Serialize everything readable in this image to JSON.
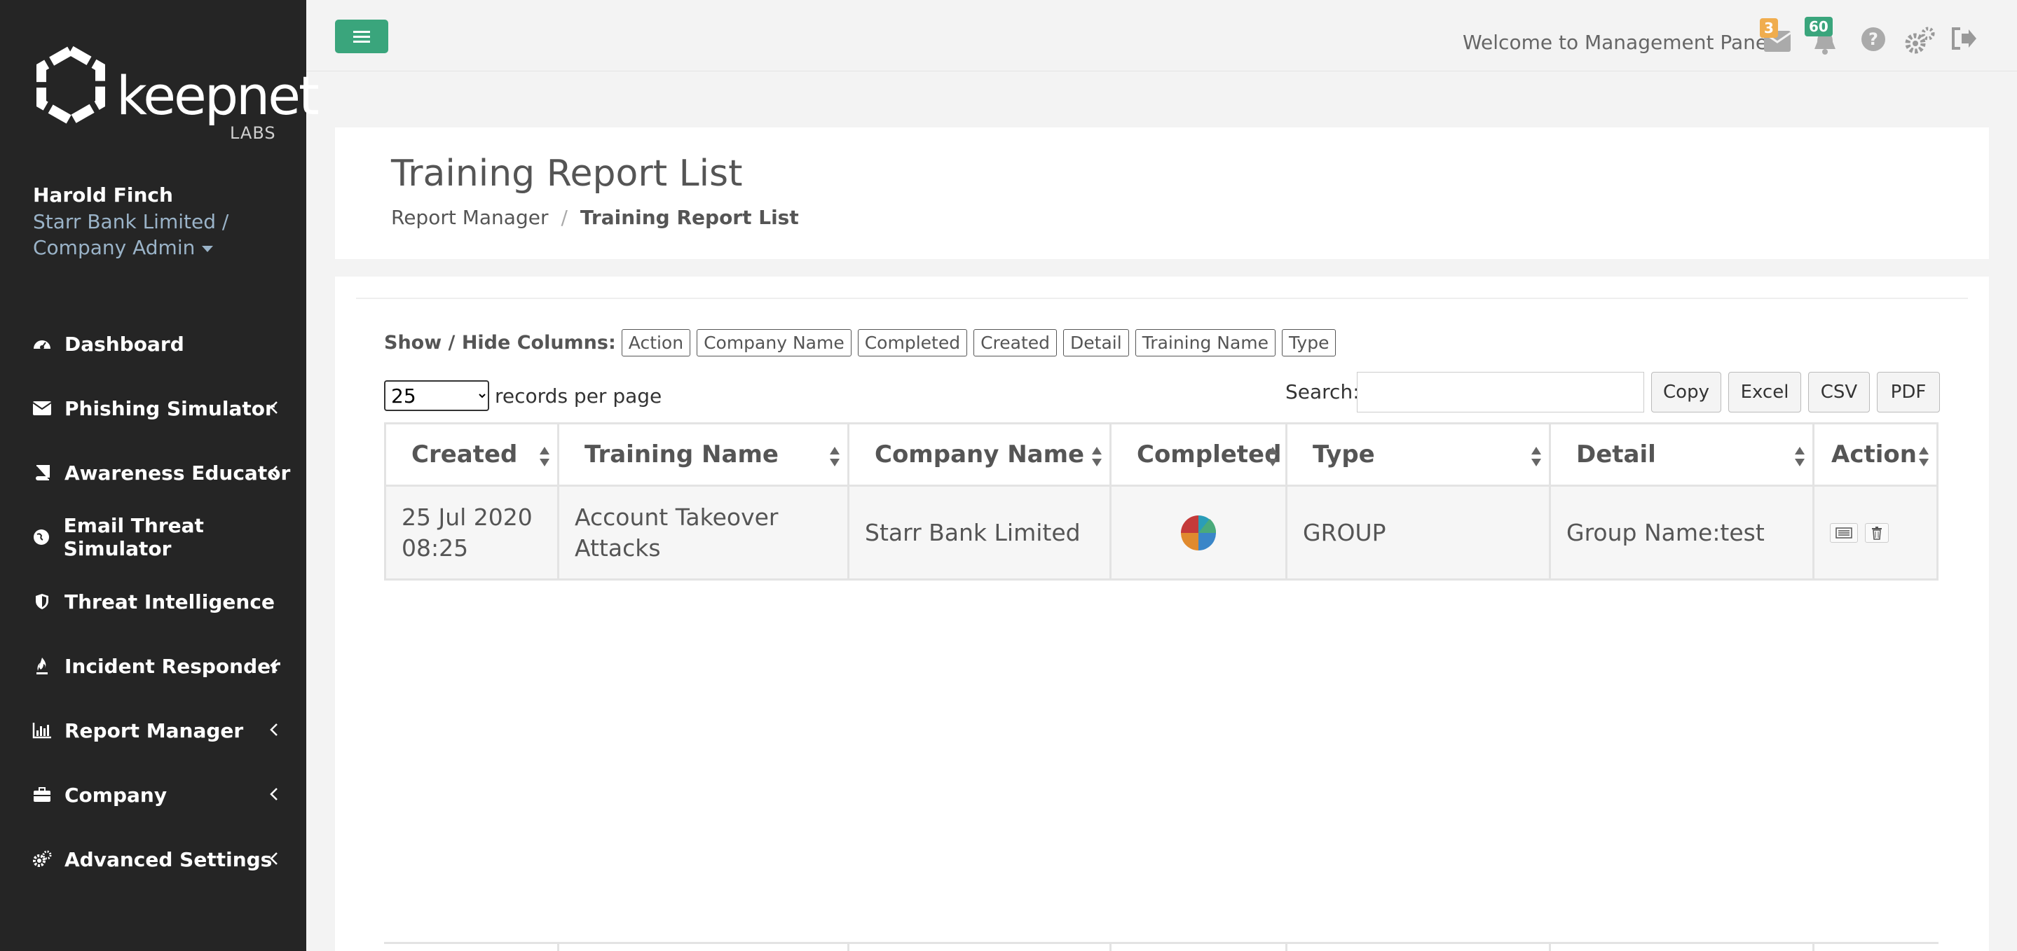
{
  "brand": {
    "name": "keepnet",
    "sub": "LABS"
  },
  "user": {
    "name": "Harold Finch",
    "org_line1": "Starr Bank Limited /",
    "org_line2": "Company Admin"
  },
  "sidebar": {
    "items": [
      {
        "label": "Dashboard",
        "icon": "dashboard-icon",
        "has_chevron": false
      },
      {
        "label": "Phishing Simulator",
        "icon": "envelope-icon",
        "has_chevron": true
      },
      {
        "label": "Awareness Educator",
        "icon": "book-icon",
        "has_chevron": true
      },
      {
        "label": "Email Threat Simulator",
        "icon": "globe-icon",
        "has_chevron": false
      },
      {
        "label": "Threat Intelligence",
        "icon": "shield-icon",
        "has_chevron": false
      },
      {
        "label": "Incident Responder",
        "icon": "fire-icon",
        "has_chevron": true
      },
      {
        "label": "Report Manager",
        "icon": "bar-chart-icon",
        "has_chevron": true
      },
      {
        "label": "Company",
        "icon": "briefcase-icon",
        "has_chevron": true
      },
      {
        "label": "Advanced Settings",
        "icon": "gears-icon",
        "has_chevron": true
      }
    ]
  },
  "topbar": {
    "welcome": "Welcome to Management Panel",
    "mail_badge": "3",
    "notif_badge": "60",
    "accent": "#3aa57c"
  },
  "page": {
    "title": "Training Report List",
    "breadcrumb_parent": "Report Manager",
    "breadcrumb_sep": "/",
    "breadcrumb_current": "Training Report List"
  },
  "controls": {
    "show_hide_label": "Show / Hide Columns:",
    "column_toggles": [
      "Action",
      "Company Name",
      "Completed",
      "Created",
      "Detail",
      "Training Name",
      "Type"
    ],
    "per_page_value": "25",
    "per_page_label": "records per page",
    "search_label": "Search:",
    "search_value": "",
    "export_buttons": [
      "Copy",
      "Excel",
      "CSV",
      "PDF"
    ]
  },
  "table": {
    "headers": [
      "Created",
      "Training Name",
      "Company Name",
      "Completed",
      "Type",
      "Detail",
      "Action"
    ],
    "rows": [
      {
        "created_line1": "25 Jul 2020",
        "created_line2": "08:25",
        "training_line1": "Account Takeover",
        "training_line2": "Attacks",
        "company": "Starr Bank Limited",
        "completed_icon": "pie-chart-icon",
        "type": "GROUP",
        "detail": "Group Name:test",
        "actions": [
          "view-details-icon",
          "delete-icon"
        ]
      }
    ]
  }
}
